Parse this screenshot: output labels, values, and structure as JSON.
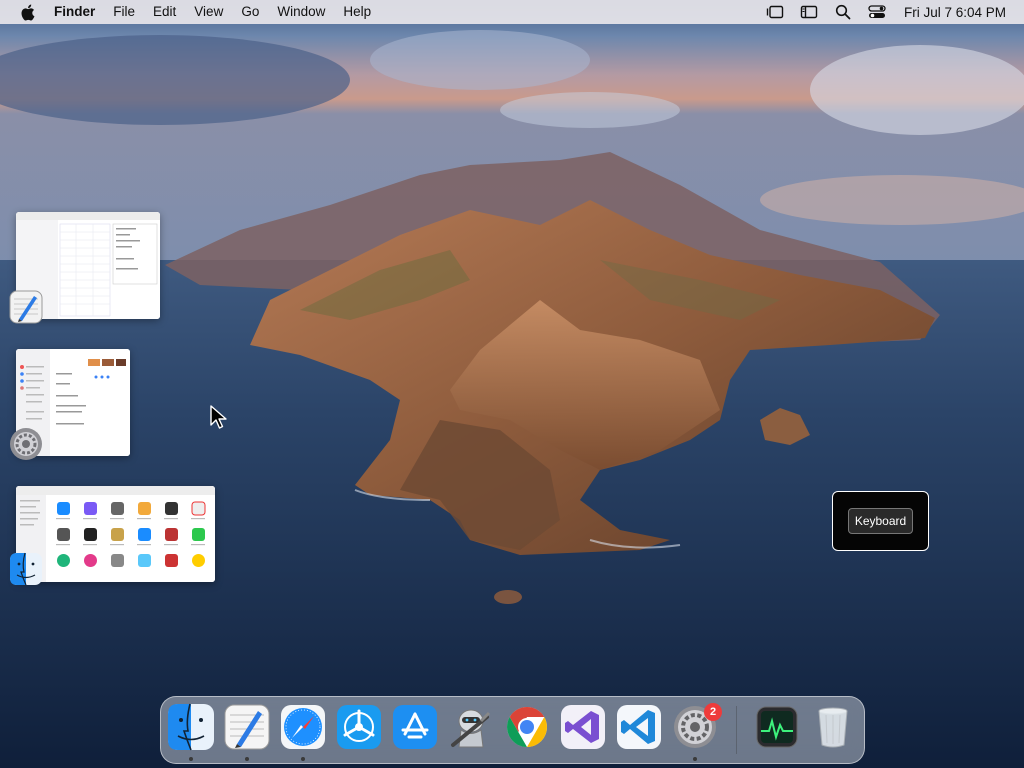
{
  "menubar": {
    "app_name": "Finder",
    "items": [
      "File",
      "Edit",
      "View",
      "Go",
      "Window",
      "Help"
    ],
    "clock": "Fri Jul 7  6:04 PM",
    "status_icons": [
      "stage-manager-icon",
      "display-icon",
      "spotlight-search-icon",
      "control-center-icon"
    ]
  },
  "stage_manager": {
    "windows": [
      {
        "app": "TextEdit",
        "icon": "textedit-icon"
      },
      {
        "app": "System Settings",
        "icon": "system-settings-icon"
      },
      {
        "app": "Finder",
        "icon": "finder-icon"
      }
    ]
  },
  "tooltip": {
    "label": "Keyboard"
  },
  "dock": {
    "items": [
      {
        "name": "finder",
        "icon": "finder-icon",
        "running": true
      },
      {
        "name": "textedit",
        "icon": "textedit-icon",
        "running": true
      },
      {
        "name": "safari",
        "icon": "safari-icon",
        "running": true
      },
      {
        "name": "testflight",
        "icon": "testflight-icon",
        "running": false
      },
      {
        "name": "app-store",
        "icon": "app-store-icon",
        "running": false
      },
      {
        "name": "automator",
        "icon": "automator-icon",
        "running": false
      },
      {
        "name": "chrome",
        "icon": "chrome-icon",
        "running": false
      },
      {
        "name": "visual-studio",
        "icon": "visual-studio-icon",
        "running": false
      },
      {
        "name": "vscode",
        "icon": "vscode-icon",
        "running": false
      },
      {
        "name": "system-settings",
        "icon": "system-settings-icon",
        "running": true,
        "badge": "2"
      },
      {
        "name": "activity-monitor",
        "icon": "activity-monitor-icon",
        "running": false
      },
      {
        "name": "trash",
        "icon": "trash-icon",
        "running": false
      }
    ]
  },
  "colors": {
    "badge": "#ee3b3b",
    "menubar": "#e8e6ea"
  }
}
